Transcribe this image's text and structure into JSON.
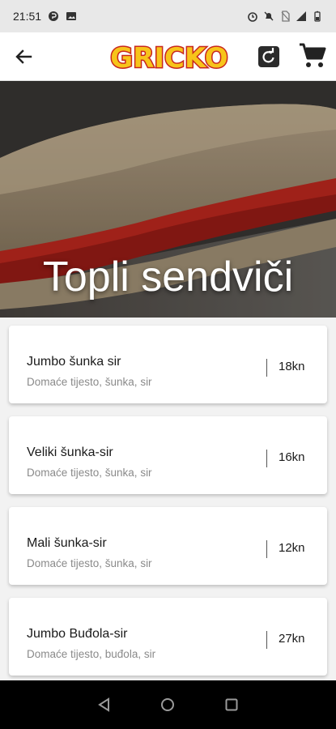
{
  "status_bar": {
    "time": "21:51"
  },
  "app_bar": {
    "logo_text": "GRICKO"
  },
  "hero": {
    "title": "Topli sendviči"
  },
  "products": [
    {
      "name": "Jumbo šunka sir",
      "desc": "Domaće tijesto, šunka, sir",
      "price": "18kn"
    },
    {
      "name": "Veliki šunka-sir",
      "desc": "Domaće tijesto, šunka, sir",
      "price": "16kn"
    },
    {
      "name": "Mali šunka-sir",
      "desc": "Domaće tijesto, šunka, sir",
      "price": "12kn"
    },
    {
      "name": "Jumbo Buđola-sir",
      "desc": "Domaće tijesto, buđola, sir",
      "price": "27kn"
    }
  ],
  "colors": {
    "logo_fill": "#f7c41a",
    "logo_stroke": "#c8261e",
    "accent": "#222222"
  }
}
